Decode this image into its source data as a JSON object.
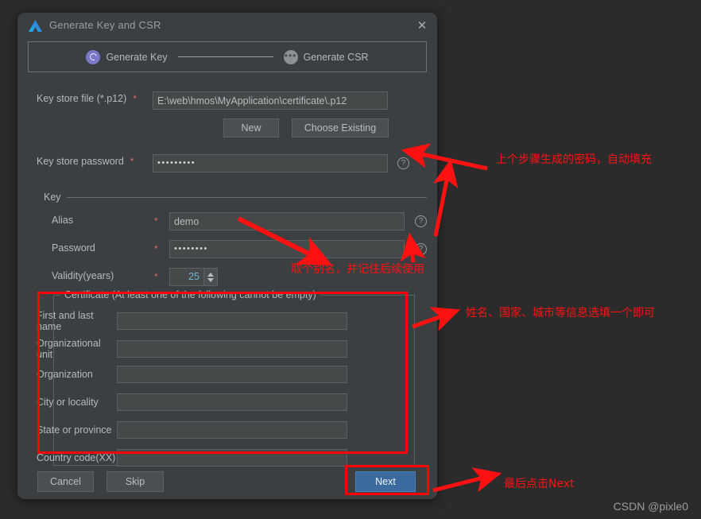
{
  "window": {
    "title": "Generate Key and CSR",
    "logo_icon": "deveco-logo-icon",
    "close_icon": "✕"
  },
  "stepper": {
    "steps": [
      {
        "label": "Generate Key",
        "state": "active",
        "icon": "spinner-ring-icon"
      },
      {
        "label": "Generate CSR",
        "state": "idle",
        "icon": "ellipsis-icon",
        "glyph": "•••"
      }
    ]
  },
  "form": {
    "keystore_file": {
      "label": "Key store file (*.p12)",
      "required_mark": "*",
      "value": "E:\\web\\hmos\\MyApplication\\certificate\\.p12",
      "placeholder": ""
    },
    "buttons": {
      "new": "New",
      "choose_existing": "Choose Existing"
    },
    "keystore_password": {
      "label": "Key store password",
      "required_mark": "*",
      "value": "•••••••••",
      "help_icon": "?"
    },
    "key_group_label": "Key",
    "alias": {
      "label": "Alias",
      "required_mark": "*",
      "value": "demo",
      "help_icon": "?"
    },
    "password": {
      "label": "Password",
      "required_mark": "*",
      "value": "••••••••",
      "help_icon": "?"
    },
    "validity": {
      "label": "Validity(years)",
      "required_mark": "*",
      "value": "25"
    }
  },
  "certificate": {
    "legend": "Certificate (At least one of the following cannot be empty)",
    "fields": [
      {
        "label": "First and last name",
        "value": ""
      },
      {
        "label": "Organizational unit",
        "value": ""
      },
      {
        "label": "Organization",
        "value": ""
      },
      {
        "label": "City or locality",
        "value": ""
      },
      {
        "label": "State or province",
        "value": ""
      },
      {
        "label": "Country code(XX)",
        "value": ""
      }
    ]
  },
  "footer": {
    "cancel": "Cancel",
    "skip": "Skip",
    "next": "Next"
  },
  "annotations": {
    "note_password": "上个步骤生成的密码，自动填充",
    "note_alias": "取个别名，并记住后续使用",
    "note_certificate": "姓名、国家、城市等信息选填一个即可",
    "note_next": "最后点击Next",
    "watermark": "CSDN @pixle0"
  },
  "colors": {
    "annotation_red": "#ff1111",
    "dialog_bg": "#3c3f41",
    "page_bg": "#2b2b2b",
    "accent_blue": "#3c6a9e",
    "step_active": "#7a79c9",
    "spinner_value": "#74b6d6"
  }
}
